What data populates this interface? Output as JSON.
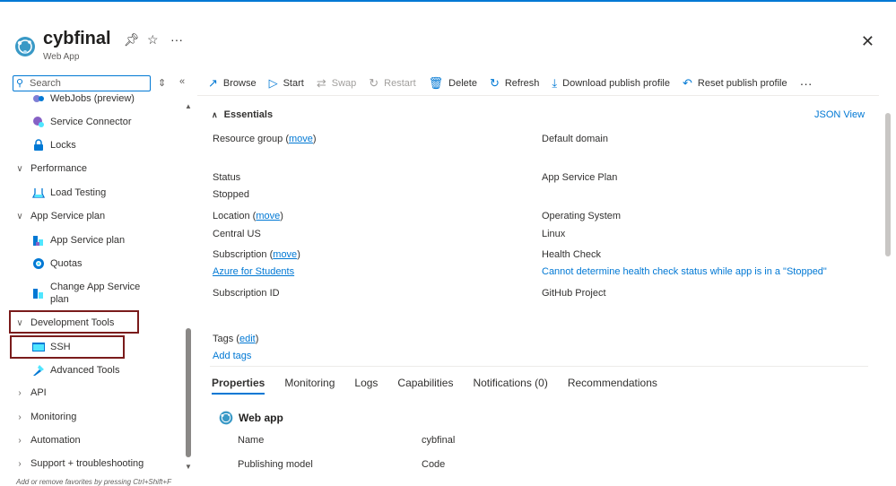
{
  "header": {
    "title": "cybfinal",
    "subtitle": "Web App",
    "pin_icon": "pin-icon",
    "star_icon": "star-icon",
    "more_icon": "more-icon",
    "close_icon": "close-icon"
  },
  "sidebar": {
    "search_placeholder": "Search",
    "items": [
      {
        "label": "WebJobs (preview)",
        "icon": "webjobs-icon",
        "level": 1
      },
      {
        "label": "Service Connector",
        "icon": "service-connector-icon",
        "level": 1
      },
      {
        "label": "Locks",
        "icon": "lock-icon",
        "level": 1
      },
      {
        "label": "Performance",
        "group": true,
        "expanded": true
      },
      {
        "label": "Load Testing",
        "icon": "load-testing-icon",
        "level": 1
      },
      {
        "label": "App Service plan",
        "group": true,
        "expanded": true
      },
      {
        "label": "App Service plan",
        "icon": "app-service-plan-icon",
        "level": 1
      },
      {
        "label": "Quotas",
        "icon": "quotas-icon",
        "level": 1
      },
      {
        "label": "Change App Service",
        "label2": "plan",
        "icon": "change-plan-icon",
        "level": 1
      },
      {
        "label": "Development Tools",
        "group": true,
        "expanded": true
      },
      {
        "label": "SSH",
        "icon": "ssh-icon",
        "level": 1
      },
      {
        "label": "Advanced Tools",
        "icon": "advanced-tools-icon",
        "level": 1
      },
      {
        "label": "API",
        "group": true,
        "expanded": false
      },
      {
        "label": "Monitoring",
        "group": true,
        "expanded": false
      },
      {
        "label": "Automation",
        "group": true,
        "expanded": false
      },
      {
        "label": "Support + troubleshooting",
        "group": true,
        "expanded": false
      }
    ],
    "hint": "Add or remove favorites by pressing Ctrl+Shift+F"
  },
  "toolbar": {
    "browse": "Browse",
    "start": "Start",
    "swap": "Swap",
    "restart": "Restart",
    "delete": "Delete",
    "refresh": "Refresh",
    "download": "Download publish profile",
    "reset": "Reset publish profile",
    "more": "···"
  },
  "essentials": {
    "title": "Essentials",
    "json_view": "JSON View",
    "resource_group_label": "Resource group",
    "move": "move",
    "default_domain_label": "Default domain",
    "status_label": "Status",
    "status_value": "Stopped",
    "app_service_plan_label": "App Service Plan",
    "location_label": "Location",
    "location_value": "Central US",
    "os_label": "Operating System",
    "os_value": "Linux",
    "subscription_label": "Subscription",
    "subscription_value": "Azure for Students",
    "health_check_label": "Health Check",
    "health_check_value": "Cannot determine health check status while app is in a \"Stopped\" sta",
    "subscription_id_label": "Subscription ID",
    "github_label": "GitHub Project",
    "tags_label": "Tags",
    "edit": "edit",
    "add_tags": "Add tags"
  },
  "tabs": [
    "Properties",
    "Monitoring",
    "Logs",
    "Capabilities",
    "Notifications (0)",
    "Recommendations"
  ],
  "properties": {
    "section_title": "Web app",
    "rows": [
      {
        "name": "Name",
        "value": "cybfinal"
      },
      {
        "name": "Publishing model",
        "value": "Code"
      }
    ]
  },
  "colors": {
    "accent": "#0078d4",
    "highlight_box": "#7a1b1b"
  }
}
